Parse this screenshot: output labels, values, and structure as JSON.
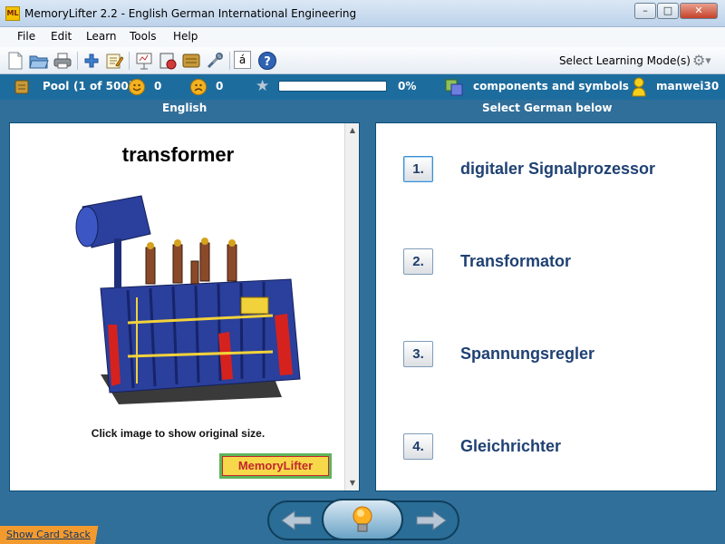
{
  "window": {
    "title": "MemoryLifter 2.2 - English German International Engineering",
    "app_icon_text": "ML"
  },
  "menu": {
    "items": [
      "File",
      "Edit",
      "Learn",
      "Tools",
      "Help"
    ]
  },
  "toolbar": {
    "mode_label": "Select Learning Mode(s)",
    "char_button": "á"
  },
  "status": {
    "pool_label": "Pool",
    "pool_count": "(1 of 500)",
    "correct_count": "0",
    "wrong_count": "0",
    "progress": 0,
    "progress_text": "0%",
    "chapter": "components and symbols",
    "user": "manwei30"
  },
  "columns": {
    "left": "English",
    "right": "Select German below"
  },
  "card": {
    "word": "transformer",
    "caption": "Click image to show original size.",
    "logo": "MemoryLifter"
  },
  "answers": [
    {
      "num": "1.",
      "text": "digitaler Signalprozessor"
    },
    {
      "num": "2.",
      "text": "Transformator"
    },
    {
      "num": "3.",
      "text": "Spannungsregler"
    },
    {
      "num": "4.",
      "text": "Gleichrichter"
    }
  ],
  "footer": {
    "card_stack_link": "Show Card Stack"
  },
  "colors": {
    "accent": "#1d6c9e",
    "answer_text": "#1f4173",
    "progress_fill": "#6fbf3a"
  }
}
